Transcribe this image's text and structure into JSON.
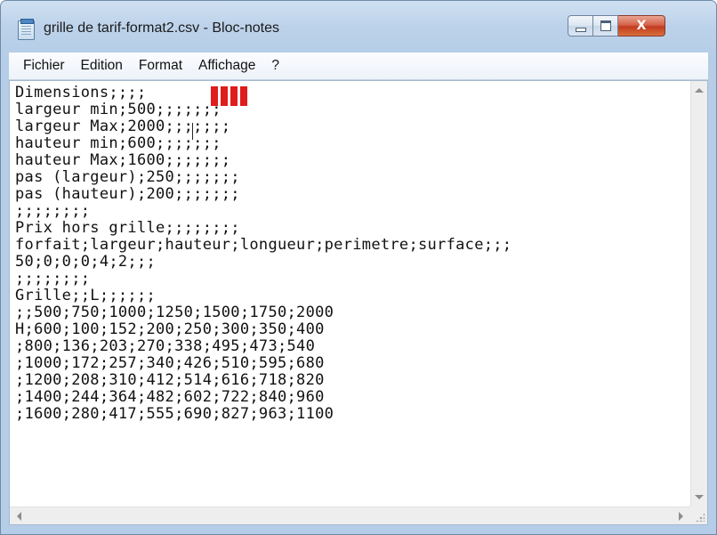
{
  "window": {
    "title": "grille de tarif-format2.csv - Bloc-notes",
    "app_icon": "notepad-icon",
    "close_symbol": "X"
  },
  "menu": {
    "items": [
      "Fichier",
      "Edition",
      "Format",
      "Affichage",
      "?"
    ]
  },
  "document": {
    "lines": [
      "Dimensions;;;;",
      "largeur min;500;;;;;;;",
      "largeur Max;2000;;;;;;;",
      "hauteur min;600;;;;;;;",
      "hauteur Max;1600;;;;;;;",
      "pas (largeur);250;;;;;;;",
      "pas (hauteur);200;;;;;;;",
      ";;;;;;;;",
      "Prix hors grille;;;;;;;;",
      "forfait;largeur;hauteur;longueur;perimetre;surface;;;",
      "50;0;0;0;4;2;;;",
      ";;;;;;;;",
      "Grille;;L;;;;;;",
      ";;500;750;1000;1250;1500;1750;2000",
      "H;600;100;152;200;250;300;350;400",
      ";800;136;203;270;338;495;473;540",
      ";1000;172;257;340;426;510;595;680",
      ";1200;208;310;412;514;616;718;820",
      ";1400;244;364;482;602;722;840;960",
      ";1600;280;417;555;690;827;963;1100"
    ]
  },
  "colors": {
    "highlight_marks": "#e01c1c",
    "title_bar": "#bcd2ea",
    "close_button": "#c9432a"
  }
}
